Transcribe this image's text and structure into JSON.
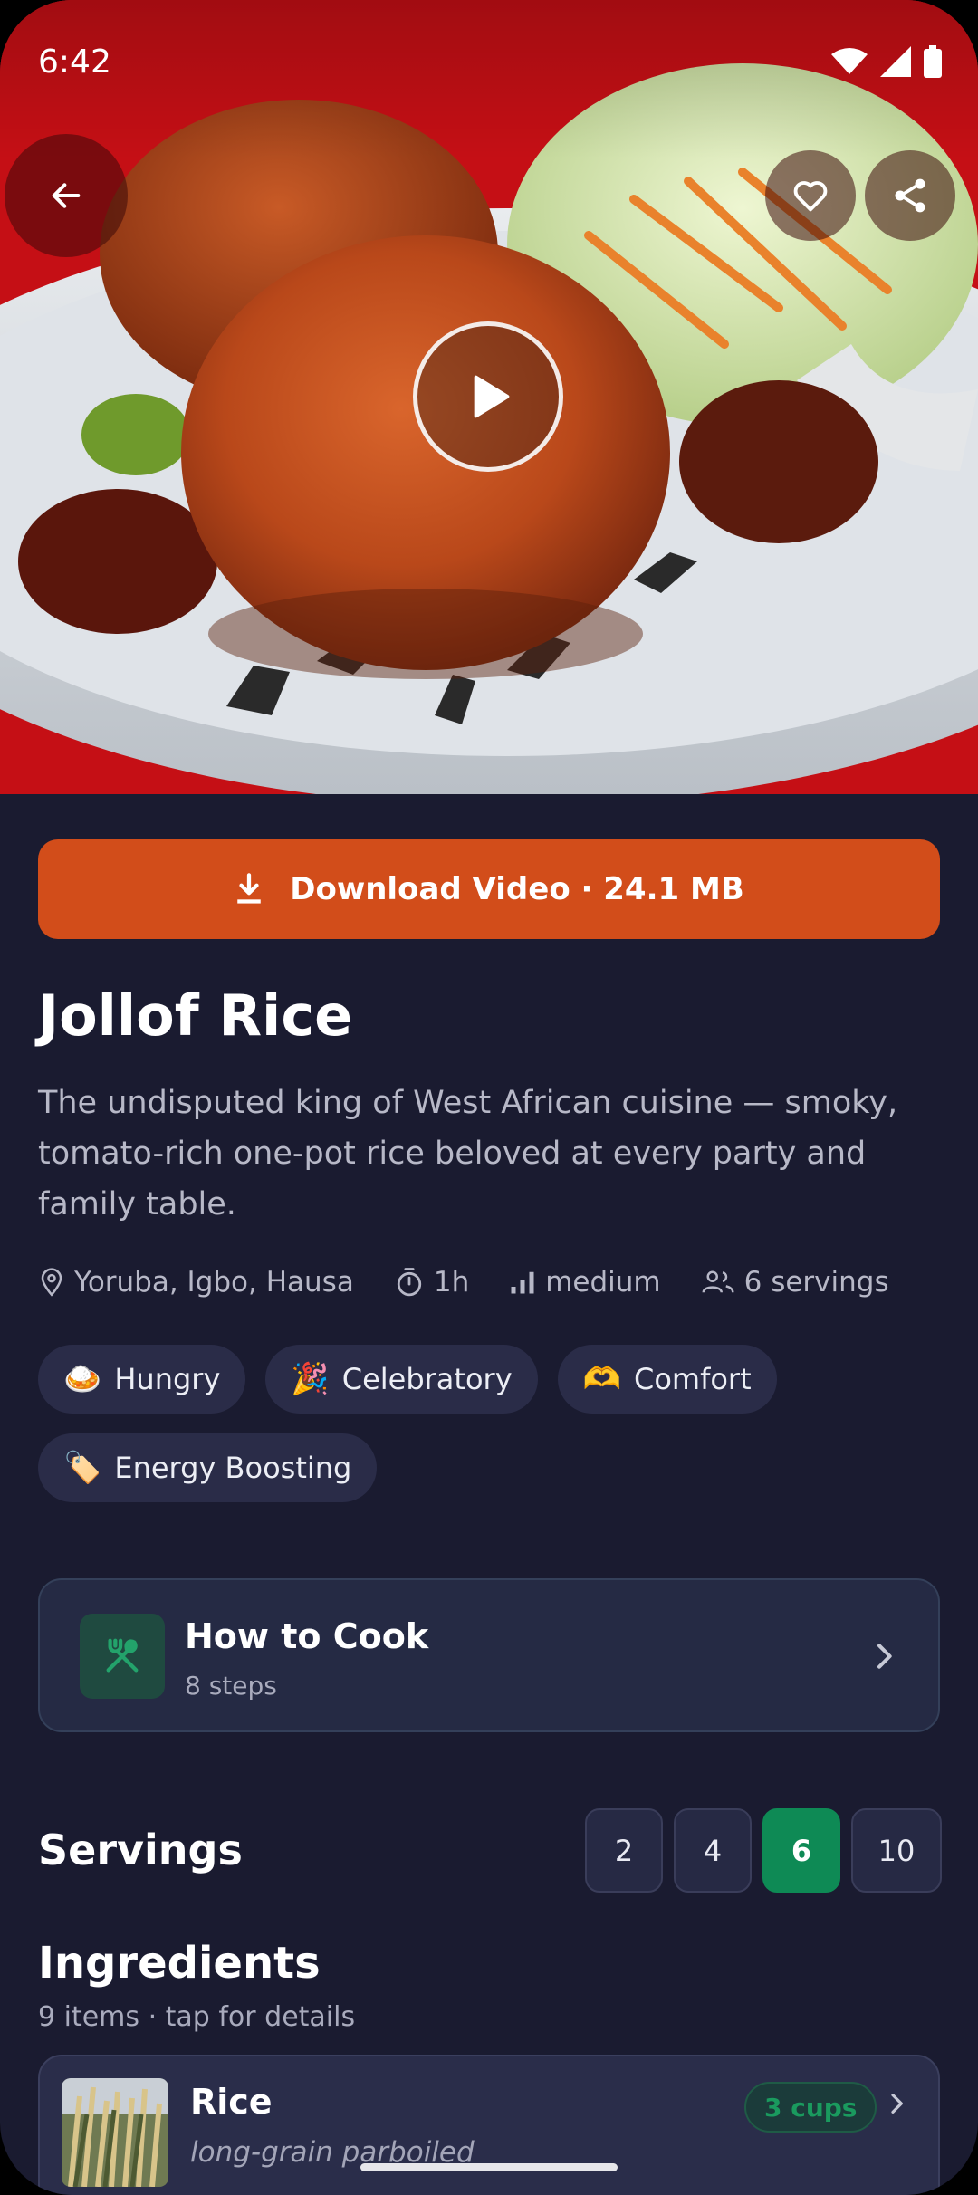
{
  "status_bar": {
    "time": "6:42"
  },
  "hero": {
    "play_icon": "play-icon",
    "back_icon": "arrow-left-icon",
    "favorite_icon": "heart-icon",
    "share_icon": "share-icon"
  },
  "download": {
    "label": "Download Video · 24.1 MB",
    "icon": "download-icon",
    "color": "#d24d1a"
  },
  "recipe": {
    "title": "Jollof Rice",
    "description": "The undisputed king of West African cuisine — smoky, tomato-rich one-pot rice beloved at every party and family table.",
    "meta": {
      "origin": "Yoruba, Igbo, Hausa",
      "time": "1h",
      "difficulty": "medium",
      "servings": "6 servings"
    },
    "tags": [
      {
        "emoji": "🍛",
        "label": "Hungry"
      },
      {
        "emoji": "🎉",
        "label": "Celebratory"
      },
      {
        "emoji": "🫶",
        "label": "Comfort"
      },
      {
        "emoji": "🏷️",
        "label": "Energy Boosting"
      }
    ]
  },
  "how_to_cook": {
    "title": "How to Cook",
    "subtitle": "8 steps",
    "icon": "utensils-icon"
  },
  "servings": {
    "label": "Servings",
    "options": [
      "2",
      "4",
      "6",
      "10"
    ],
    "selected": "6",
    "accent": "#0e8a55"
  },
  "ingredients": {
    "title": "Ingredients",
    "subtitle": "9 items · tap for details",
    "items": [
      {
        "name": "Rice",
        "note": "long-grain parboiled",
        "amount": "3 cups"
      }
    ]
  }
}
